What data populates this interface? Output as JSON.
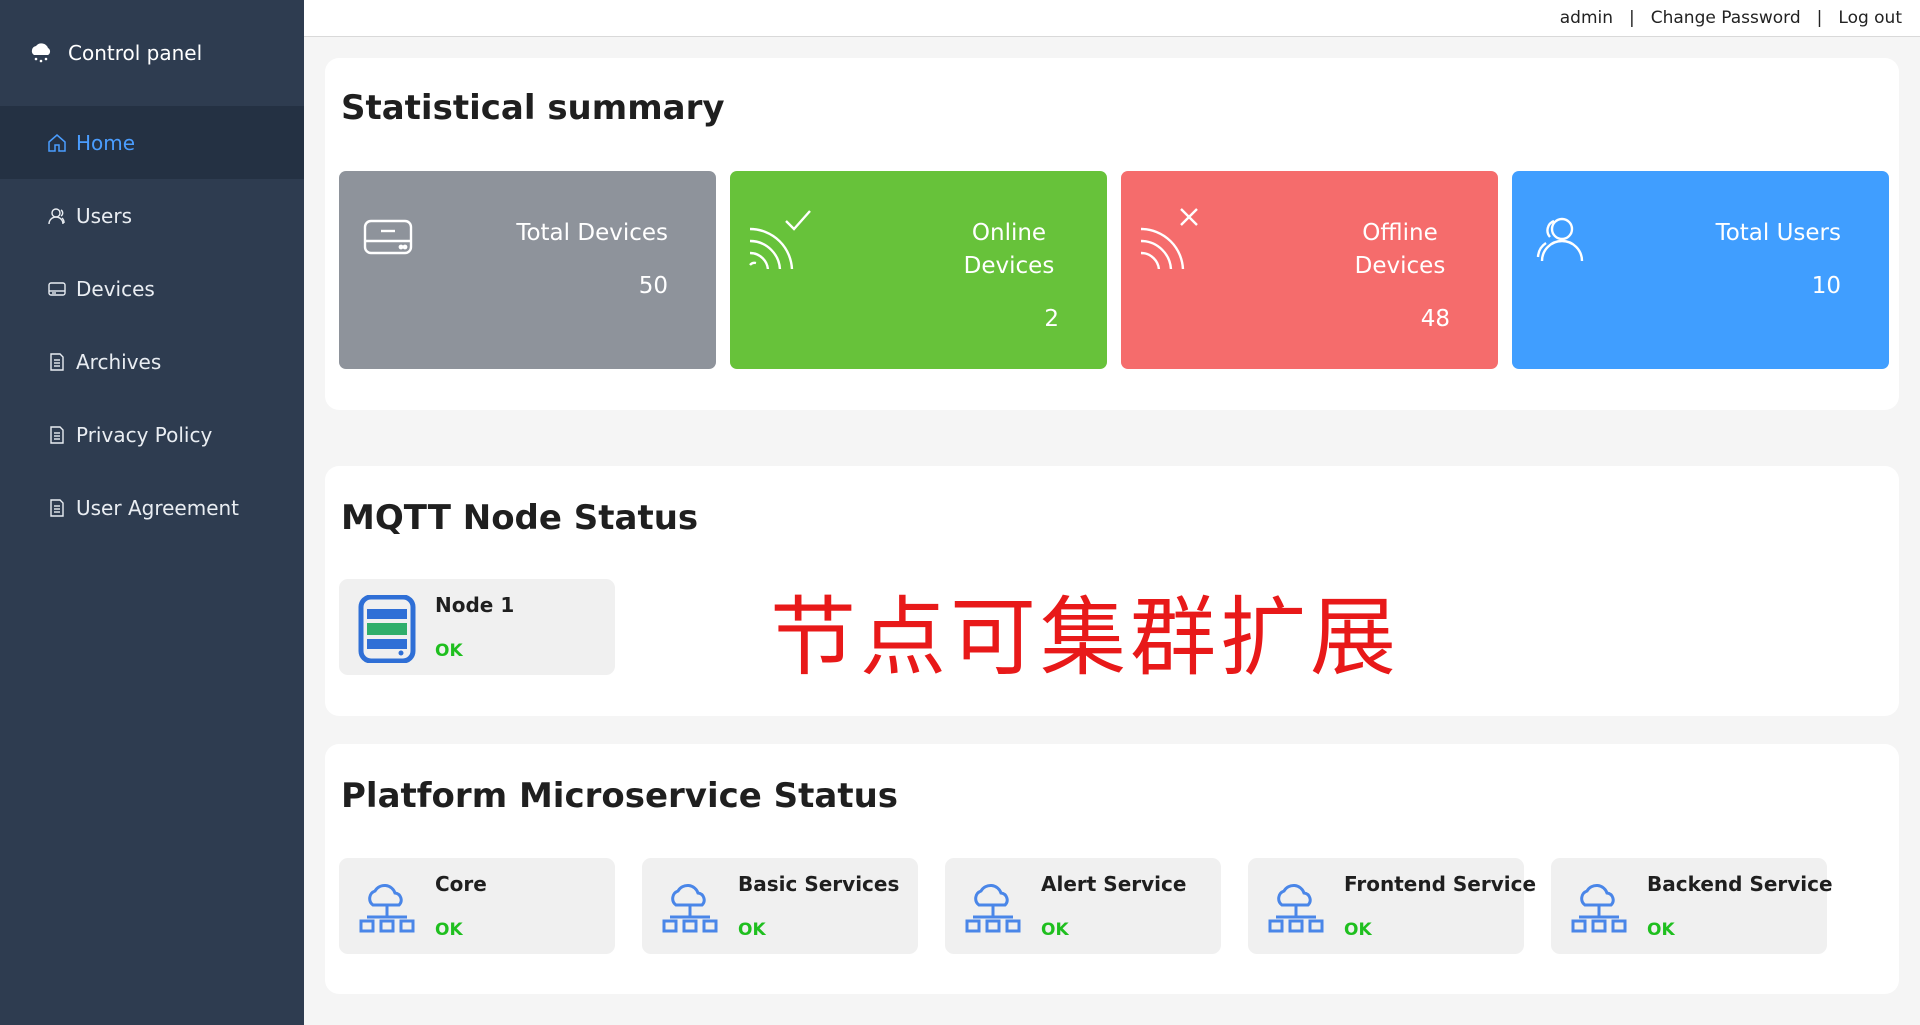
{
  "sidebar": {
    "brand": "Control panel",
    "items": [
      {
        "label": "Home",
        "icon": "home-icon"
      },
      {
        "label": "Users",
        "icon": "user-icon"
      },
      {
        "label": "Devices",
        "icon": "device-icon"
      },
      {
        "label": "Archives",
        "icon": "document-icon"
      },
      {
        "label": "Privacy Policy",
        "icon": "document-icon"
      },
      {
        "label": "User Agreement",
        "icon": "document-icon"
      }
    ]
  },
  "topbar": {
    "user": "admin",
    "change_password": "Change Password",
    "logout": "Log out"
  },
  "summary": {
    "title": "Statistical summary",
    "cards": [
      {
        "label": "Total Devices",
        "value": "50",
        "color": "#8e939b"
      },
      {
        "label": "Online Devices",
        "value": "2",
        "color": "#67c23a"
      },
      {
        "label": "Offline Devices",
        "value": "48",
        "color": "#f56c6c"
      },
      {
        "label": "Total Users",
        "value": "10",
        "color": "#409eff"
      }
    ]
  },
  "mqtt": {
    "title": "MQTT Node Status",
    "nodes": [
      {
        "name": "Node 1",
        "status": "OK"
      }
    ],
    "overlay_text": "节点可集群扩展"
  },
  "microservices": {
    "title": "Platform Microservice Status",
    "services": [
      {
        "name": "Core",
        "status": "OK"
      },
      {
        "name": "Basic Services",
        "status": "OK"
      },
      {
        "name": "Alert Service",
        "status": "OK"
      },
      {
        "name": "Frontend Service",
        "status": "OK"
      },
      {
        "name": "Backend Service",
        "status": "OK"
      }
    ]
  }
}
